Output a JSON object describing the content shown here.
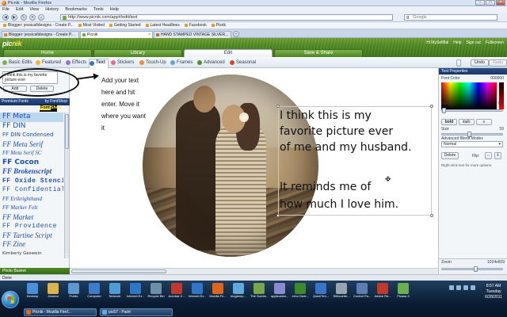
{
  "window": {
    "title": "Picnik - Mozilla Firefox",
    "menu": [
      "File",
      "Edit",
      "View",
      "History",
      "Bookmarks",
      "Tools",
      "Help"
    ],
    "url": "http://www.picnik.com/app#/edit/text",
    "search_placeholder": "Google"
  },
  "bookmarks": [
    "Blogger: jessicafidesigns - Create P...",
    "Most Visited",
    "Getting Started",
    "Latest Headlines",
    "Facebook",
    "Pixrik"
  ],
  "tabs": [
    {
      "label": "Blogger: jessicafidesigns - Create P...",
      "active": false
    },
    {
      "label": "Picnik",
      "active": true
    },
    {
      "label": "HAND STAMPED VINTAGE SILVER...",
      "active": false
    }
  ],
  "picnik": {
    "logo_main": "pic",
    "logo_accent": "nik",
    "header_links": [
      "Hi MySelf8al",
      "Help",
      "Sign out",
      "Fullscreen"
    ],
    "main_tabs": [
      "Home",
      "Library",
      "Edit",
      "Save & Share"
    ],
    "sub_tabs": [
      "Basic Edits",
      "Featured",
      "Effects",
      "Text",
      "Stickers",
      "Touch-Up",
      "Frames",
      "Advanced",
      "Seasonal"
    ],
    "undo": "Undo",
    "redo": "Redo"
  },
  "left_panel": {
    "text_value": "I think this is my favorite picture ever",
    "add_label": "Add",
    "delete_label": "Delete",
    "fonts_header": "Premium Fonts",
    "fonts_by": "by FontShop",
    "fontshop_a": "Font",
    "fontshop_b": "Shop",
    "fonts": [
      "FF Meta",
      "FF DIN",
      "FF DIN Condensed",
      "FF Meta Serif",
      "FF Meta Serif SC",
      "FF Cocon",
      "FF Brokenscript",
      "FF Oxide Stencil",
      "FF Confidential",
      "FF Erikrighthand",
      "FF Marker Felt",
      "FF Market",
      "FF Providence",
      "FF Tartine Script",
      "FF Zine",
      "Kimberly Geswein"
    ],
    "photo_basket": "Photo Basket"
  },
  "annotation": {
    "callout": "Add your text here and hit enter. Move it where you want it"
  },
  "canvas": {
    "text_lines": [
      "I think this is my",
      "favorite picture ever",
      "of me and my husband.",
      "",
      "It reminds me of",
      "how much I love him."
    ]
  },
  "right_panel": {
    "title": "Text Properties",
    "font_color_label": "Font Color",
    "font_color_value": "000000",
    "fade_label": "Fade",
    "fade_value": "0%",
    "fade_level": 0,
    "bold": "bold",
    "italic": "italic",
    "size_label": "Size",
    "size_value": "59",
    "size_level": 0.45,
    "blend_label": "Advanced Blend Modes",
    "blend_value": "Normal",
    "delete_label": "Delete",
    "flip_label": "Flip:",
    "hint": "Right-click text for more options."
  },
  "zoom": {
    "label": "Zoom",
    "value": "1024x609",
    "level": 0.55
  },
  "status": "Done",
  "taskbar": {
    "icons": [
      "Desktop",
      "Jessica",
      "Public",
      "Computer",
      "Network",
      "Internet Ex...",
      "Recycle Bin",
      "Acrobat X...",
      "Internet Ex...",
      "Mozilla Fir...",
      "blogtemp...",
      "The Scenic...",
      "application...",
      "John Deer...",
      "QuickTim...",
      "Silhouette...",
      "Control Pa...",
      "Adobe Re...",
      "Picasa 3"
    ],
    "tasks": [
      "Picnik - Mozilla Firef...",
      "pic67 - Paint"
    ],
    "time": "8:57 AM",
    "day": "Tuesday",
    "date": "6/28/2011"
  }
}
